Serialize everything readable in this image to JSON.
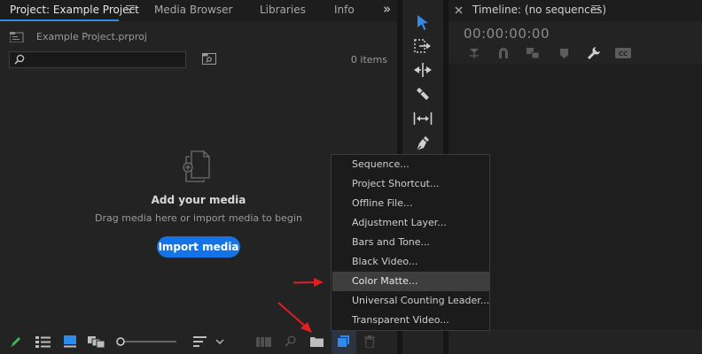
{
  "project": {
    "tabs": [
      {
        "label": "Project: Example Project",
        "active": true
      },
      {
        "label": "Media Browser",
        "active": false
      },
      {
        "label": "Libraries",
        "active": false
      },
      {
        "label": "Info",
        "active": false
      }
    ],
    "overflow_glyph": "»",
    "file_name": "Example Project.prproj",
    "search_placeholder": "",
    "items_count": "0 items",
    "empty_state": {
      "title": "Add your media",
      "subtitle": "Drag media here or import media to begin",
      "button": "Import media"
    },
    "bottom_bar_icons": [
      "pencil-icon",
      "list-view-icon",
      "icon-view-icon",
      "freeform-view-icon",
      "zoom-slider",
      "sort-icon",
      "chevron-down-icon",
      "automate-to-sequence-icon",
      "find-icon",
      "new-bin-icon",
      "new-item-icon",
      "trash-icon"
    ]
  },
  "tools": [
    "selection-tool-icon",
    "track-select-tool-icon",
    "ripple-edit-tool-icon",
    "razor-tool-icon",
    "slip-tool-icon",
    "pen-tool-icon"
  ],
  "timeline": {
    "title": "Timeline: (no sequences)",
    "timecode": "00:00:00:00",
    "toolbar_icons": [
      "insert-snap-icon",
      "magnet-icon",
      "linked-selection-icon",
      "marker-icon",
      "wrench-icon",
      "captions-icon"
    ]
  },
  "context_menu": {
    "items": [
      "Sequence...",
      "Project Shortcut...",
      "Offline File...",
      "Adjustment Layer...",
      "Bars and Tone...",
      "Black Video...",
      "Color Matte...",
      "Universal Counting Leader...",
      "Transparent Video..."
    ],
    "hovered_index": 6
  },
  "colors": {
    "accent": "#2d8ceb",
    "button": "#1473e6",
    "annotation_arrow": "#e02020",
    "pencil": "#3fb950"
  }
}
